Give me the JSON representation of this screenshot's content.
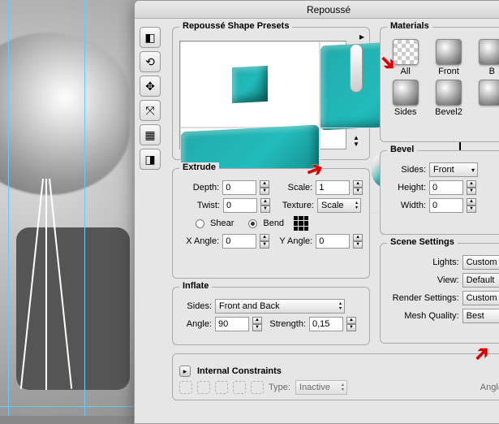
{
  "window": {
    "title": "Repoussé"
  },
  "sections": {
    "presets": "Repoussé Shape Presets",
    "extrude": "Extrude",
    "inflate": "Inflate",
    "constraints": "Internal Constraints",
    "materials": "Materials",
    "bevel": "Bevel",
    "scene": "Scene Settings"
  },
  "extrude": {
    "depth_lbl": "Depth:",
    "depth": "0",
    "scale_lbl": "Scale:",
    "scale": "1",
    "twist_lbl": "Twist:",
    "twist": "0",
    "texture_lbl": "Texture:",
    "texture": "Scale",
    "shear_lbl": "Shear",
    "bend_lbl": "Bend",
    "xangle_lbl": "X Angle:",
    "xangle": "0",
    "yangle_lbl": "Y Angle:",
    "yangle": "0"
  },
  "inflate": {
    "sides_lbl": "Sides:",
    "sides": "Front and Back",
    "angle_lbl": "Angle:",
    "angle": "90",
    "strength_lbl": "Strength:",
    "strength": "0,15"
  },
  "constraints": {
    "type_lbl": "Type:",
    "type": "Inactive",
    "angle_lbl": "Angle:"
  },
  "materials": {
    "items": [
      "All",
      "Front",
      "B",
      "Sides",
      "Bevel2",
      ""
    ]
  },
  "bevel": {
    "sides_lbl": "Sides:",
    "sides": "Front",
    "height_lbl": "Height:",
    "height": "0",
    "width_lbl": "Width:",
    "width": "0"
  },
  "scene": {
    "lights_lbl": "Lights:",
    "lights": "Custom",
    "view_lbl": "View:",
    "view": "Default",
    "render_lbl": "Render Settings:",
    "render": "Custom",
    "mesh_lbl": "Mesh Quality:",
    "mesh": "Best"
  }
}
